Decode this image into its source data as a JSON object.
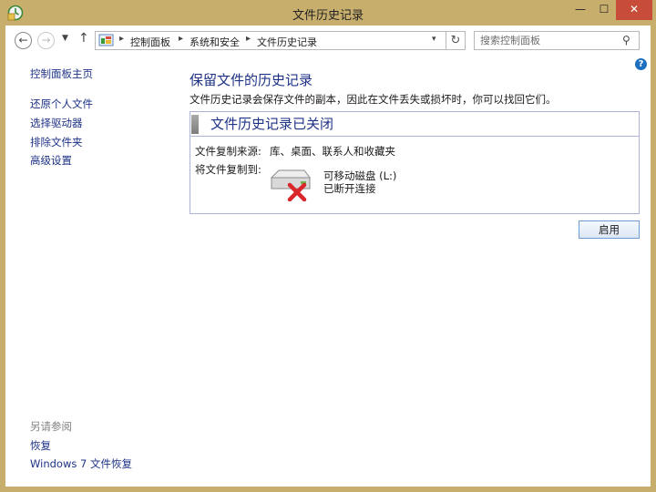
{
  "window": {
    "title": "文件历史记录",
    "buttons": {
      "minimize": "—",
      "maximize": "☐",
      "close": "✕"
    },
    "frame_color": "#c8ae6c",
    "close_color": "#c74d3a"
  },
  "nav": {
    "breadcrumb": [
      "控制面板",
      "系统和安全",
      "文件历史记录"
    ],
    "search_placeholder": "搜索控制面板"
  },
  "sidebar": {
    "home": "控制面板主页",
    "links": [
      "还原个人文件",
      "选择驱动器",
      "排除文件夹",
      "高级设置"
    ],
    "see_also_title": "另请参阅",
    "see_also_links": [
      "恢复",
      "Windows 7 文件恢复"
    ]
  },
  "main": {
    "heading": "保留文件的历史记录",
    "description": "文件历史记录会保存文件的副本，因此在文件丢失或损坏时，你可以找回它们。",
    "panel": {
      "status_title": "文件历史记录已关闭",
      "source_label": "文件复制来源:",
      "source_value": "库、桌面、联系人和收藏夹",
      "target_label": "将文件复制到:",
      "drive_name": "可移动磁盘 (L:)",
      "drive_status": "已断开连接"
    },
    "enable_button": "启用"
  },
  "colors": {
    "link": "#1e3287",
    "panel_border": "#a9b4d8",
    "error_red": "#d9262b"
  }
}
